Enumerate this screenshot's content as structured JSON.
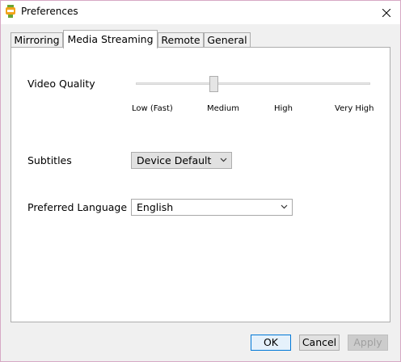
{
  "window": {
    "title": "Preferences"
  },
  "tabs": [
    {
      "label": "Mirroring",
      "active": false
    },
    {
      "label": "Media Streaming",
      "active": true
    },
    {
      "label": "Remote",
      "active": false
    },
    {
      "label": "General",
      "active": false
    }
  ],
  "video_quality": {
    "label": "Video Quality",
    "levels": [
      "Low (Fast)",
      "Medium",
      "High",
      "Very High"
    ],
    "selected": "Medium"
  },
  "subtitles": {
    "label": "Subtitles",
    "value": "Device Default"
  },
  "preferred_language": {
    "label": "Preferred Language",
    "value": "English"
  },
  "buttons": {
    "ok": "OK",
    "cancel": "Cancel",
    "apply": "Apply"
  },
  "colors": {
    "accent": "#0078d7",
    "window_border": "#d7a9c5"
  },
  "icons": {
    "app": "app-icon",
    "close": "close-icon",
    "dropdown": "chevron-down-icon"
  }
}
